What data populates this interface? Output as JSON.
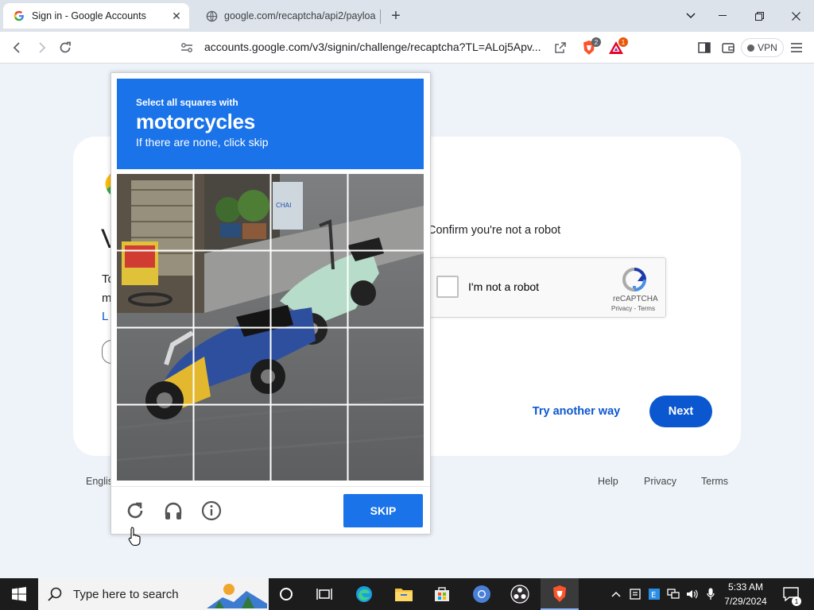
{
  "browser": {
    "tabs": [
      {
        "title": "Sign in - Google Accounts",
        "favicon": "google-g-icon",
        "active": true
      },
      {
        "title": "google.com/recaptcha/api2/payloa",
        "favicon": "globe-icon",
        "active": false
      }
    ],
    "url": "accounts.google.com/v3/signin/challenge/recaptcha?TL=ALoj5Apv...",
    "vpn_label": "VPN",
    "brave_shield_badge": "2",
    "rewards_badge": "1"
  },
  "signin": {
    "partial_texts": [
      "V",
      "To",
      "m",
      "L",
      "("
    ],
    "confirm_text": "Confirm you're not a robot",
    "checkbox_label": "I'm not a robot",
    "recaptcha_brand": "reCAPTCHA",
    "recaptcha_links": "Privacy - Terms",
    "try_another_label": "Try another way",
    "next_label": "Next",
    "footer": {
      "language": "Englis",
      "help": "Help",
      "privacy": "Privacy",
      "terms": "Terms"
    }
  },
  "challenge": {
    "instruction_line1": "Select all squares with",
    "target_object": "motorcycles",
    "instruction_line3": "If there are none, click skip",
    "grid_size": 4,
    "skip_label": "SKIP",
    "icons": [
      "reload-icon",
      "audio-headphones-icon",
      "info-icon"
    ]
  },
  "taskbar": {
    "search_placeholder": "Type here to search",
    "time": "5:33 AM",
    "date": "7/29/2024",
    "notification_count": "1"
  },
  "colors": {
    "challenge_blue": "#1a73e8",
    "next_blue": "#0b57d0",
    "page_bg": "#eef3f9"
  }
}
